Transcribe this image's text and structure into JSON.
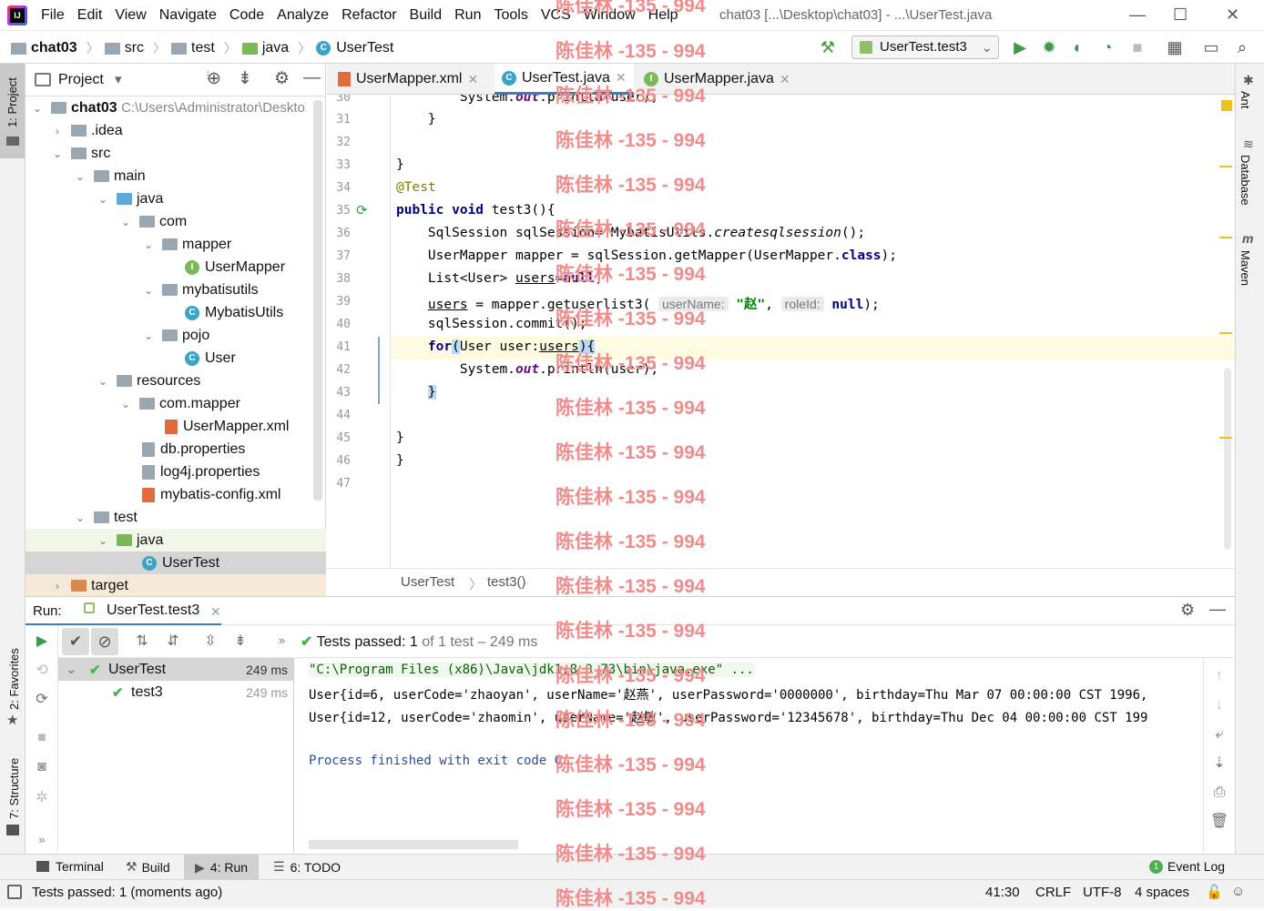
{
  "menubar": {
    "logo": "IJ",
    "items": [
      "File",
      "Edit",
      "View",
      "Navigate",
      "Code",
      "Analyze",
      "Refactor",
      "Build",
      "Run",
      "Tools",
      "VCS",
      "Window",
      "Help"
    ],
    "window_title": "chat03 [...\\Desktop\\chat03] - ...\\UserTest.java"
  },
  "navbar": {
    "crumbs": [
      "chat03",
      "src",
      "test",
      "java",
      "UserTest"
    ],
    "run_config": "UserTest.test3"
  },
  "leftstrip": {
    "project_tab": "1: Project",
    "favorites_tab": "2: Favorites",
    "structure_tab": "7: Structure"
  },
  "rightstrip": {
    "ant": "Ant",
    "database": "Database",
    "maven": "Maven"
  },
  "project": {
    "title": "Project",
    "tree": [
      {
        "label": "chat03",
        "extra": "C:\\Users\\Administrator\\Deskto"
      },
      {
        "label": ".idea"
      },
      {
        "label": "src"
      },
      {
        "label": "main"
      },
      {
        "label": "java"
      },
      {
        "label": "com"
      },
      {
        "label": "mapper"
      },
      {
        "label": "UserMapper"
      },
      {
        "label": "mybatisutils"
      },
      {
        "label": "MybatisUtils"
      },
      {
        "label": "pojo"
      },
      {
        "label": "User"
      },
      {
        "label": "resources"
      },
      {
        "label": "com.mapper"
      },
      {
        "label": "UserMapper.xml"
      },
      {
        "label": "db.properties"
      },
      {
        "label": "log4j.properties"
      },
      {
        "label": "mybatis-config.xml"
      },
      {
        "label": "test"
      },
      {
        "label": "java"
      },
      {
        "label": "UserTest"
      },
      {
        "label": "target"
      }
    ]
  },
  "editor": {
    "tabs": [
      "UserMapper.xml",
      "UserTest.java",
      "UserMapper.java"
    ],
    "line_numbers": [
      "30",
      "31",
      "32",
      "33",
      "34",
      "35",
      "36",
      "37",
      "38",
      "39",
      "40",
      "41",
      "42",
      "43",
      "44",
      "45",
      "46",
      "47"
    ],
    "breadcrumb": [
      "UserTest",
      "test3()"
    ],
    "hints": {
      "user_name": "userName:",
      "role_id": "roleId:"
    }
  },
  "run": {
    "label": "Run:",
    "tab": "UserTest.test3",
    "status_main": "Tests passed:",
    "status_count": "1",
    "status_rest": "of 1 test – 249 ms",
    "tree": [
      {
        "label": "UserTest",
        "time": "249 ms"
      },
      {
        "label": "test3",
        "time": "249 ms"
      }
    ],
    "console": [
      "\"C:\\Program Files (x86)\\Java\\jdk1.8.0_73\\bin\\java.exe\" ...",
      "User{id=6, userCode='zhaoyan', userName='赵燕', userPassword='0000000', birthday=Thu Mar 07 00:00:00 CST 1996,",
      "User{id=12, userCode='zhaomin', userName='赵敏', userPassword='12345678', birthday=Thu Dec 04 00:00:00 CST 199",
      "",
      "Process finished with exit code 0"
    ]
  },
  "bottom_tools": {
    "terminal": "Terminal",
    "build": "Build",
    "run": "4: Run",
    "todo": "6: TODO",
    "event_log": "Event Log"
  },
  "status": {
    "message": "Tests passed: 1 (moments ago)",
    "position": "41:30",
    "line_sep": "CRLF",
    "encoding": "UTF-8",
    "indent": "4 spaces"
  },
  "watermark": "陈佳林 -135 - 994",
  "colors": {
    "keyword": "#000080",
    "string": "#008000",
    "annotation": "#808000",
    "field": "#660e7a",
    "watermark": "#f28b8b",
    "pass": "#4caf50"
  }
}
